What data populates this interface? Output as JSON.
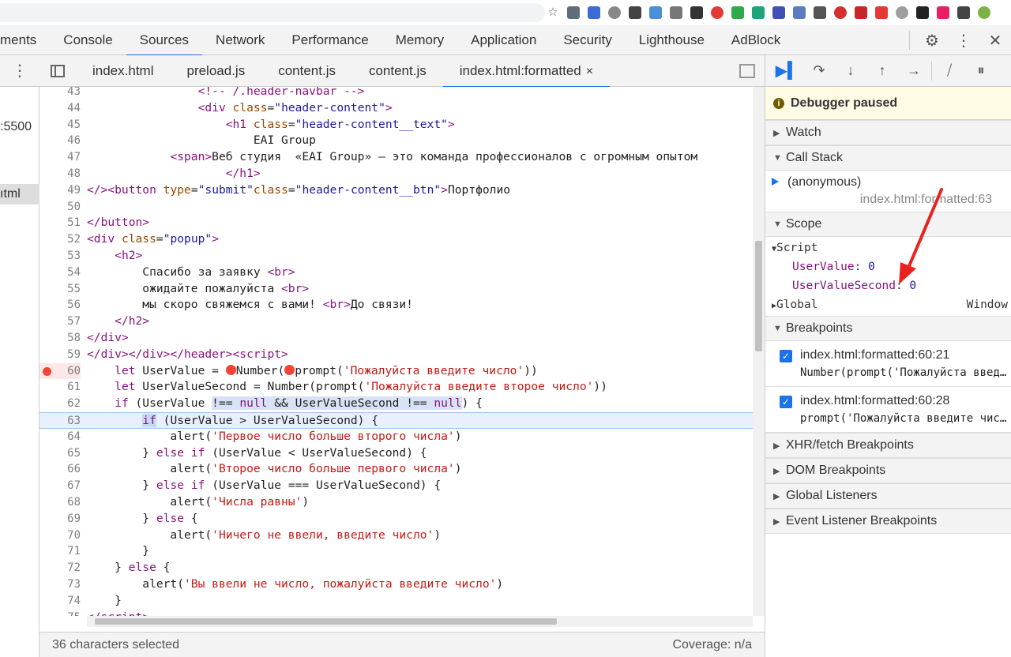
{
  "devtools_tabs": [
    "ments",
    "Console",
    "Sources",
    "Network",
    "Performance",
    "Memory",
    "Application",
    "Security",
    "Lighthouse",
    "AdBlock"
  ],
  "active_tab": "Sources",
  "navigator": {
    "row1": ":5500",
    "row2": "ıtml"
  },
  "file_tabs": [
    {
      "label": "index.html"
    },
    {
      "label": "preload.js"
    },
    {
      "label": "content.js"
    },
    {
      "label": "content.js"
    },
    {
      "label": "index.html:formatted",
      "active": true,
      "close": "×"
    }
  ],
  "code_lines": [
    {
      "n": "43",
      "html": "                <span class='tag'>&lt;!-- /.header-navbar --&gt;</span>"
    },
    {
      "n": "44",
      "html": "                <span class='tag'>&lt;div</span> <span class='attr'>class</span>=<span class='str'>\"header-content\"</span><span class='tag'>&gt;</span>"
    },
    {
      "n": "45",
      "html": "                    <span class='tag'>&lt;h1</span> <span class='attr'>class</span>=<span class='str'>\"header-content__text\"</span><span class='tag'>&gt;</span>"
    },
    {
      "n": "46",
      "html": "                        EAI Group"
    },
    {
      "n": "47",
      "html": "            <span class='tag'>&lt;span&gt;</span>Веб студия  «EAI Group» — это команда профессионалов с огромным опытом"
    },
    {
      "n": "48",
      "html": "                    <span class='tag'>&lt;/h1&gt;</span>"
    },
    {
      "n": "49",
      "html": "<span class='tag'>&lt;/&gt;&lt;button</span> <span class='attr'>type</span>=<span class='str'>\"submit\"</span><span class='attr'>class</span>=<span class='str'>\"header-content__btn\"</span><span class='tag'>&gt;</span>Портфолио"
    },
    {
      "n": "50",
      "html": ""
    },
    {
      "n": "51",
      "html": "<span class='tag'>&lt;/button&gt;</span>"
    },
    {
      "n": "52",
      "html": "<span class='tag'>&lt;div</span> <span class='attr'>class</span>=<span class='str'>\"popup\"</span><span class='tag'>&gt;</span>"
    },
    {
      "n": "53",
      "html": "    <span class='tag'>&lt;h2&gt;</span>"
    },
    {
      "n": "54",
      "html": "        Спасибо за заявку <span class='tag'>&lt;br&gt;</span>"
    },
    {
      "n": "55",
      "html": "        ожидайте пожалуйста <span class='tag'>&lt;br&gt;</span>"
    },
    {
      "n": "56",
      "html": "        мы скоро свяжемся с вами! <span class='tag'>&lt;br&gt;</span>До связи!"
    },
    {
      "n": "57",
      "html": "    <span class='tag'>&lt;/h2&gt;</span>"
    },
    {
      "n": "58",
      "html": "<span class='tag'>&lt;/div&gt;</span>"
    },
    {
      "n": "59",
      "html": "<span class='tag'>&lt;/div&gt;&lt;/div&gt;&lt;/header&gt;&lt;script&gt;</span>"
    },
    {
      "n": "60",
      "bp": true,
      "html": "    <span class='kw'>let</span> UserValue = <span class='inl-bp'></span>Number(<span class='inl-bp'></span>prompt(<span class='rstr'>'Пожалуйста введите число'</span>))"
    },
    {
      "n": "61",
      "html": "    <span class='kw'>let</span> UserValueSecond = Number(prompt(<span class='rstr'>'Пожалуйста введите второе число'</span>))"
    },
    {
      "n": "62",
      "html": "    <span class='kw'>if</span> (UserValue <span class='sel-hl'>!== <span class='kw'>null</span> &amp;&amp; UserValueSecond !== <span class='kw'>null</span></span>) {"
    },
    {
      "n": "63",
      "cur": true,
      "html": "        <span class='kw kw-hl'>if</span> (UserValue &gt; UserValueSecond) {"
    },
    {
      "n": "64",
      "html": "            alert(<span class='rstr'>'Первое число больше второго числа'</span>)"
    },
    {
      "n": "65",
      "html": "        } <span class='kw'>else</span> <span class='kw'>if</span> (UserValue &lt; UserValueSecond) {"
    },
    {
      "n": "66",
      "html": "            alert(<span class='rstr'>'Второе число больше первого числа'</span>)"
    },
    {
      "n": "67",
      "html": "        } <span class='kw'>else</span> <span class='kw'>if</span> (UserValue === UserValueSecond) {"
    },
    {
      "n": "68",
      "html": "            alert(<span class='rstr'>'Числа равны'</span>)"
    },
    {
      "n": "69",
      "html": "        } <span class='kw'>else</span> {"
    },
    {
      "n": "70",
      "html": "            alert(<span class='rstr'>'Ничего не ввели, введите число'</span>)"
    },
    {
      "n": "71",
      "html": "        }"
    },
    {
      "n": "72",
      "html": "    } <span class='kw'>else</span> {"
    },
    {
      "n": "73",
      "html": "        alert(<span class='rstr'>'Вы ввели не число, пожалуйста введите число'</span>)"
    },
    {
      "n": "74",
      "html": "    }"
    },
    {
      "n": "75",
      "html": "<span class='tag'>&lt;/script&gt;</span>"
    }
  ],
  "footer": {
    "left": "36 characters selected",
    "right": "Coverage: n/a"
  },
  "debugger": {
    "paused_label": "Debugger paused",
    "info_glyph": "i",
    "watch": "Watch",
    "call_stack": "Call Stack",
    "frame_name": "(anonymous)",
    "frame_loc": "index.html:formatted:63",
    "scope": "Scope",
    "script": "Script",
    "var1_name": "UserValue",
    "var1_value": "0",
    "var2_name": "UserValueSecond",
    "var2_value": "0",
    "global": "Global",
    "global_value": "Window",
    "breakpoints": "Breakpoints",
    "bp1_loc": "index.html:formatted:60:21",
    "bp1_code": "Number(prompt('Пожалуйста введите число'))",
    "bp2_loc": "index.html:formatted:60:28",
    "bp2_code": "prompt('Пожалуйста введите число')",
    "xhr": "XHR/fetch Breakpoints",
    "dom": "DOM Breakpoints",
    "global_listeners": "Global Listeners",
    "event_listeners": "Event Listener Breakpoints"
  },
  "colors": {
    "accent": "#1a73e8",
    "breakpoint": "#f44336",
    "paused_bg": "#fffbe5",
    "annotation_arrow": "#e8231f"
  }
}
